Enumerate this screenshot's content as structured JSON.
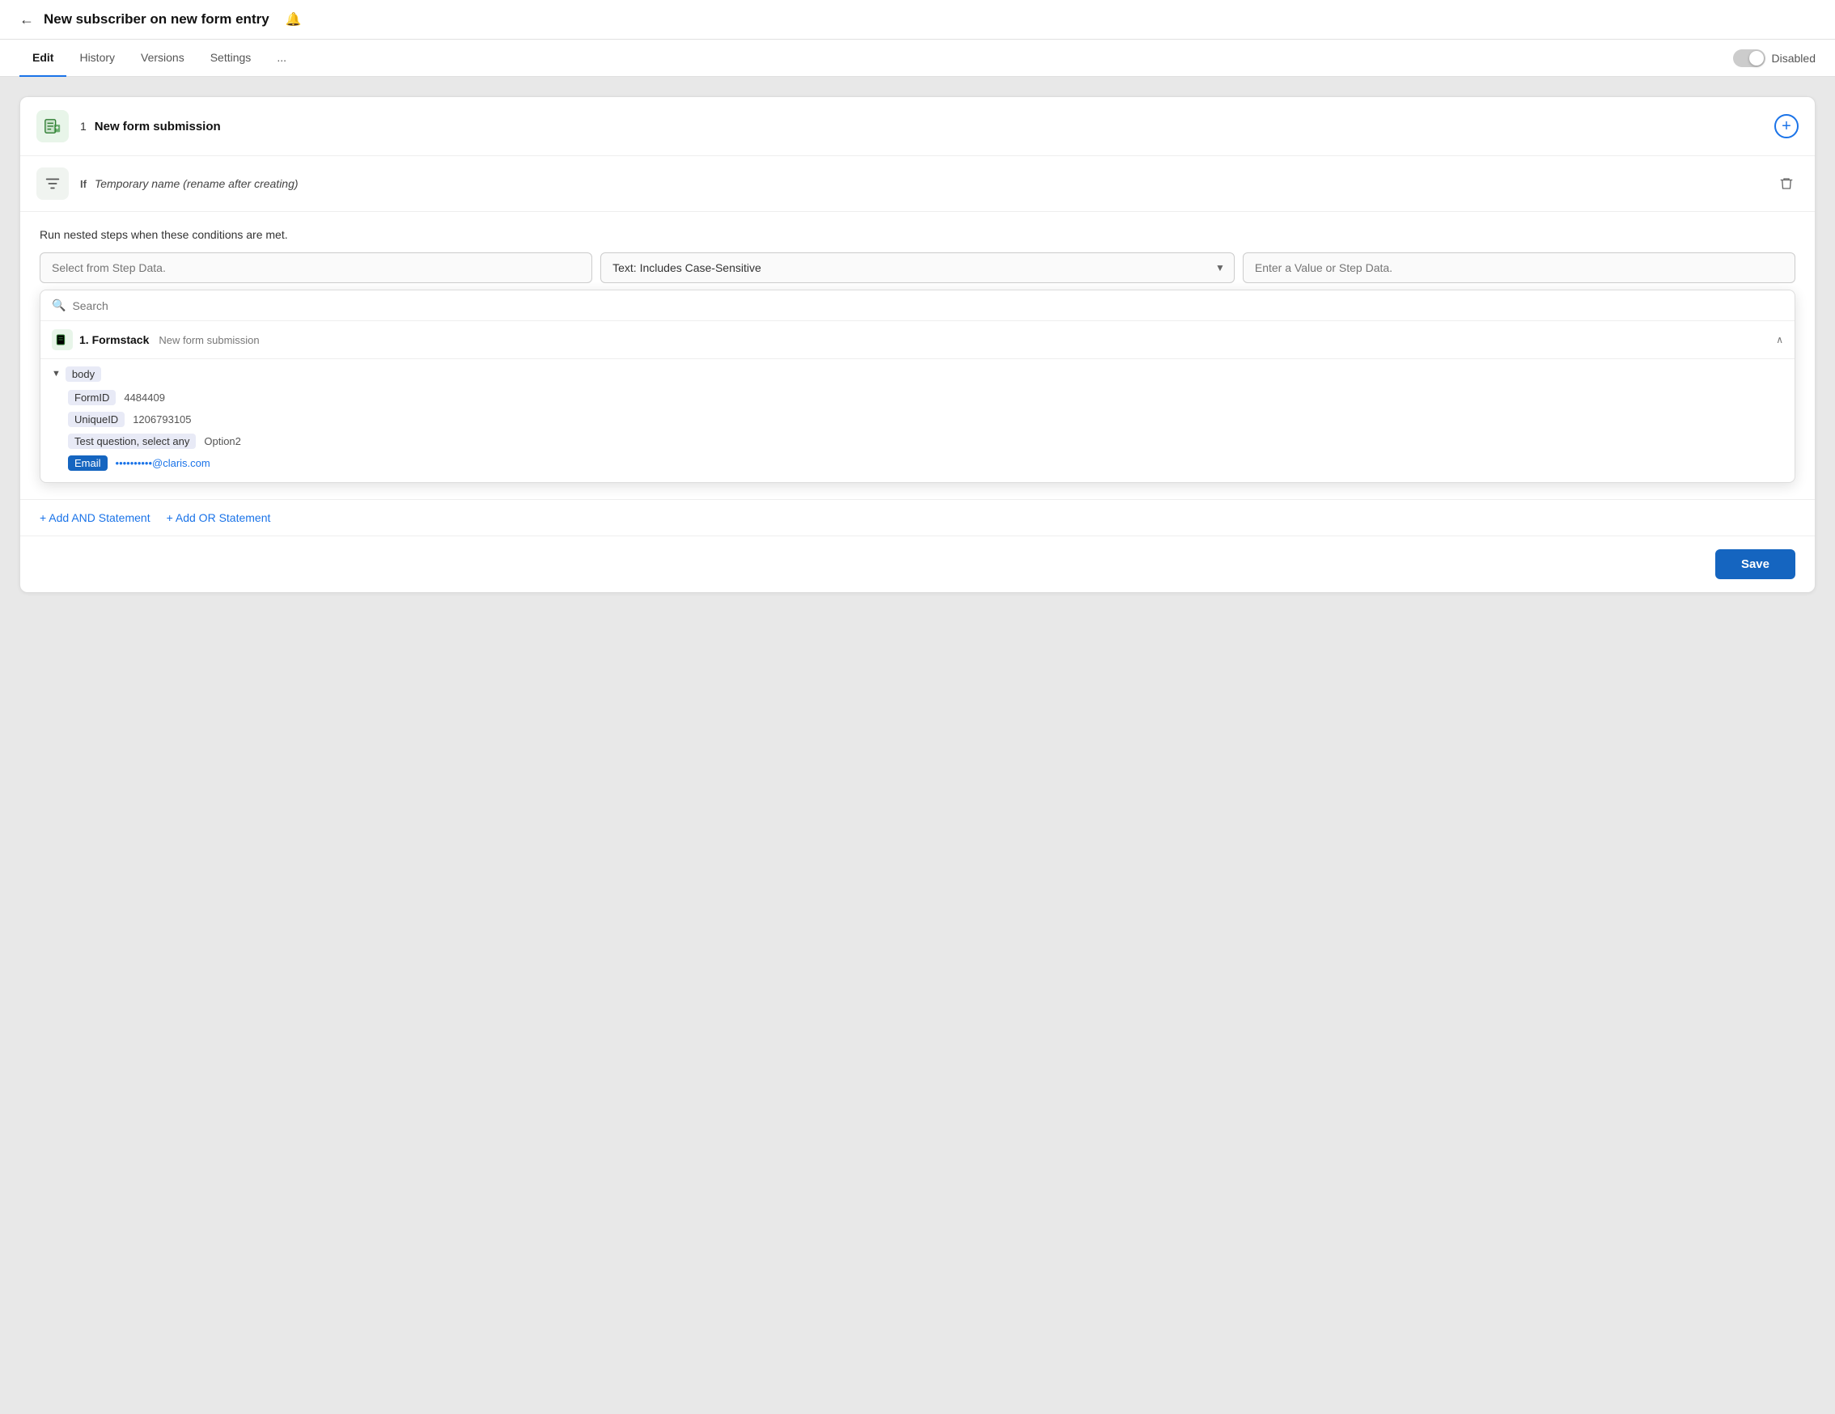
{
  "header": {
    "back_label": "←",
    "title": "New subscriber on new form entry",
    "bell_icon": "🔔"
  },
  "tabs": {
    "items": [
      {
        "label": "Edit",
        "active": true
      },
      {
        "label": "History",
        "active": false
      },
      {
        "label": "Versions",
        "active": false
      },
      {
        "label": "Settings",
        "active": false
      },
      {
        "label": "...",
        "active": false
      }
    ],
    "toggle_label": "Disabled"
  },
  "step1": {
    "number": "1",
    "title": "New form submission",
    "add_icon": "+"
  },
  "step2": {
    "if_label": "If",
    "name": "Temporary name (rename after creating)",
    "delete_icon": "🗑"
  },
  "condition": {
    "description": "Run nested steps when these conditions are met.",
    "input1_placeholder": "Select from Step Data.",
    "select_value": "Text: Includes Case-Sensitive",
    "input2_placeholder": "Enter a Value or Step Data.",
    "search_placeholder": "Search",
    "formstack_label": "1. Formstack",
    "formstack_sublabel": "New form submission",
    "body_label": "body",
    "fields": [
      {
        "key": "FormID",
        "value": "4484409",
        "blue": false
      },
      {
        "key": "UniqueID",
        "value": "1206793105",
        "blue": false
      },
      {
        "key": "Test question, select any",
        "value": "Option2",
        "blue": false
      },
      {
        "key": "Email",
        "value": "••••••••••@claris.com",
        "blue": true
      }
    ]
  },
  "statements": {
    "and_label": "+ Add AND Statement",
    "or_label": "+ Add OR Statement"
  },
  "footer": {
    "save_label": "Save"
  }
}
